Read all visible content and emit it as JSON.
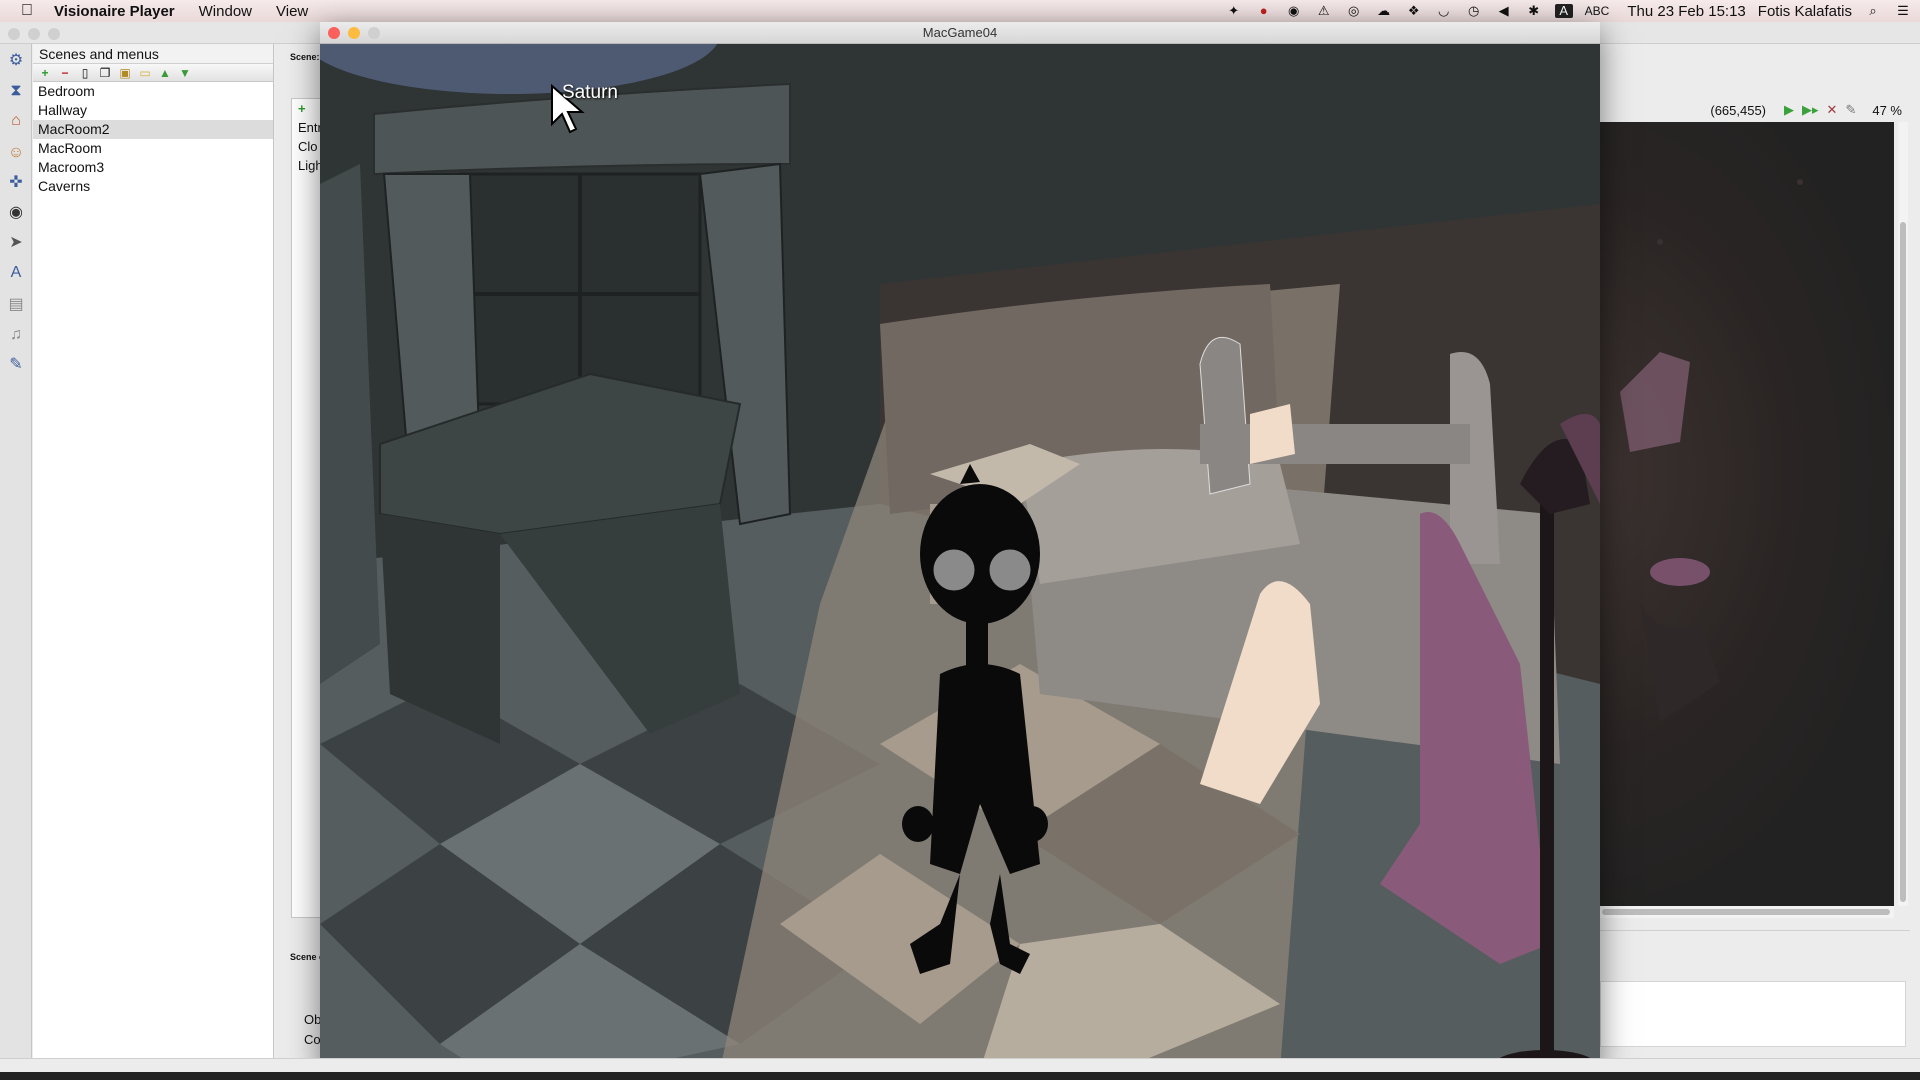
{
  "menubar": {
    "app_name": "Visionaire Player",
    "menus": [
      "Window",
      "View"
    ],
    "status": {
      "keyboard_layout": "ABC",
      "datetime": "Thu 23 Feb  15:13",
      "user": "Fotis Kalafatis"
    }
  },
  "editor": {
    "scenes_panel": {
      "title": "Scenes and menus",
      "items": [
        "Bedroom",
        "Hallway",
        "MacRoom2",
        "MacRoom",
        "Macroom3",
        "Caverns"
      ],
      "selected": "MacRoom2"
    },
    "mid_panel": {
      "scene_label": "Scene:",
      "items": [
        "Entr",
        "Clo",
        "Ligh"
      ],
      "scene_conditions_label": "Scene c",
      "lower_items": [
        "Ob",
        "Co"
      ]
    },
    "preview": {
      "coordinates": "(665,455)",
      "zoom": "47 %"
    }
  },
  "game_window": {
    "title": "MacGame04",
    "hover_label": "Saturn"
  },
  "colors": {
    "close": "#fc605c",
    "minimize": "#fdbc40",
    "zoom": "#34c84a",
    "inactive_dot": "#d0d0d0",
    "coat": "#8a5a7a"
  }
}
